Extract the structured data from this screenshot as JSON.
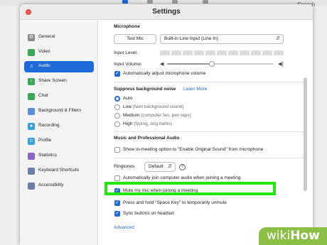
{
  "window": {
    "title": "Settings"
  },
  "background": {
    "search_label": "Search"
  },
  "sidebar": {
    "items": [
      {
        "label": "General",
        "icon": "gear-icon",
        "color": "#8a8a8a"
      },
      {
        "label": "Video",
        "icon": "video-camera-icon",
        "color": "#3aa657"
      },
      {
        "label": "Audio",
        "icon": "headphones-icon",
        "color": "#ffffff",
        "active": true
      },
      {
        "label": "Share Screen",
        "icon": "share-screen-icon",
        "color": "#3aa657"
      },
      {
        "label": "Chat",
        "icon": "chat-bubble-icon",
        "color": "#3aa657"
      },
      {
        "label": "Background & Filters",
        "icon": "background-filter-icon",
        "color": "#5a8fd8"
      },
      {
        "label": "Recording",
        "icon": "record-icon",
        "color": "#3aa0d8"
      },
      {
        "label": "Profile",
        "icon": "profile-icon",
        "color": "#3aa0d8"
      },
      {
        "label": "Statistics",
        "icon": "statistics-icon",
        "color": "#8a67c9"
      },
      {
        "label": "Keyboard Shortcuts",
        "icon": "keyboard-icon",
        "color": "#6b7fa8"
      },
      {
        "label": "Accessibility",
        "icon": "accessibility-icon",
        "color": "#6b7fa8"
      }
    ]
  },
  "audio": {
    "microphone": {
      "section_title": "Microphone",
      "test_button": "Test Mic",
      "device": "Built-in Line Input (Line In)",
      "input_level_label": "Input Level:",
      "input_volume_label": "Input Volume:",
      "input_volume_fraction": 0.42,
      "auto_adjust_label": "Automatically adjust microphone volume"
    },
    "noise": {
      "section_title": "Suppress background noise",
      "learn_more": "Learn More",
      "options": [
        {
          "label": "Auto",
          "hint": "",
          "selected": true
        },
        {
          "label": "Low",
          "hint": "(faint background sound)",
          "selected": false
        },
        {
          "label": "Medium",
          "hint": "(computer fan, pen taps)",
          "selected": false
        },
        {
          "label": "High",
          "hint": "(typing, dog barks)",
          "selected": false
        }
      ]
    },
    "music": {
      "section_title": "Music and Professional Audio",
      "original_sound_label": "Show in-meeting option to \"Enable Original Sound\" from microphone"
    },
    "ringtones": {
      "label": "Ringtones",
      "value": "Default"
    },
    "checkboxes": [
      {
        "label": "Automatically join computer audio when joining a meeting",
        "checked": false
      },
      {
        "label": "Mute my mic when joining a meeting",
        "checked": true
      },
      {
        "label": "Press and hold \"Space Key\" to temporarily unmute",
        "checked": true
      },
      {
        "label": "Sync buttons on headset",
        "checked": true
      }
    ],
    "advanced_link": "Advanced"
  },
  "watermark": {
    "brand_light": "wiki",
    "brand_bold": "How"
  },
  "colors": {
    "accent": "#1d6ad8",
    "highlight": "#22e80f",
    "watermark": "#8bbf46"
  }
}
